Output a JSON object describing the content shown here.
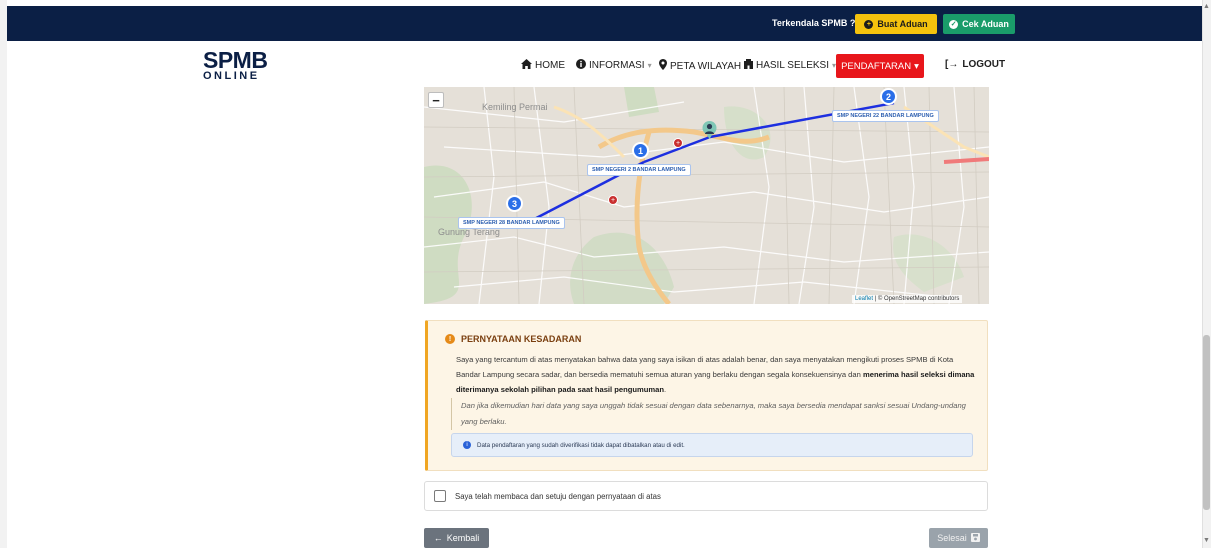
{
  "topbar": {
    "help_text": "Terkendala SPMB ?",
    "buat_aduan": "Buat Aduan",
    "cek_aduan": "Cek Aduan",
    "colors": {
      "bar": "#0b1f45",
      "aduan": "#f4c20d",
      "cek": "#1a9c6a"
    }
  },
  "logo": {
    "main": "SPMB",
    "sub": "ONLINE"
  },
  "nav": {
    "home": "HOME",
    "informasi": "INFORMASI",
    "peta": "PETA WILAYAH",
    "hasil": "HASIL SELEKSI",
    "pendaftaran": "PENDAFTARAN",
    "logout": "LOGOUT",
    "pendaftaran_color": "#e8161b"
  },
  "map": {
    "zoom_out": "−",
    "places": {
      "kemiling": "Kemiling Permai",
      "gunung": "Gunung Terang"
    },
    "schools": [
      {
        "number": "1",
        "name": "SMP NEGERI 2 BANDAR LAMPUNG"
      },
      {
        "number": "2",
        "name": "SMP NEGERI 22 BANDAR LAMPUNG"
      },
      {
        "number": "3",
        "name": "SMP NEGERI 28 BANDAR LAMPUNG"
      }
    ],
    "attribution_leaflet": "Leaflet",
    "attribution_rest": "| © OpenStreetMap contributors"
  },
  "statement": {
    "title": "PERNYATAAN KESADARAN",
    "body_plain": "Saya yang tercantum di atas menyatakan bahwa data yang saya isikan di atas adalah benar, dan saya menyatakan mengikuti proses SPMB di Kota Bandar Lampung secara sadar, dan bersedia mematuhi semua aturan yang berlaku dengan segala konsekuensinya dan ",
    "body_bold": "menerima hasil seleksi dimana diterimanya sekolah pilihan pada saat hasil pengumuman",
    "body_end": ".",
    "quote": "Dan jika dikemudian hari data yang saya unggah tidak sesuai dengan data sebenarnya, maka saya bersedia mendapat sanksi sesuai Undang-undang yang berlaku.",
    "info": "Data pendaftaran yang sudah diverifikasi tidak dapat dibatalkan atau di edit."
  },
  "agreement": {
    "label": "Saya telah membaca dan setuju dengan pernyataan di atas",
    "checked": false
  },
  "actions": {
    "back": "Kembali",
    "done": "Selesai"
  }
}
